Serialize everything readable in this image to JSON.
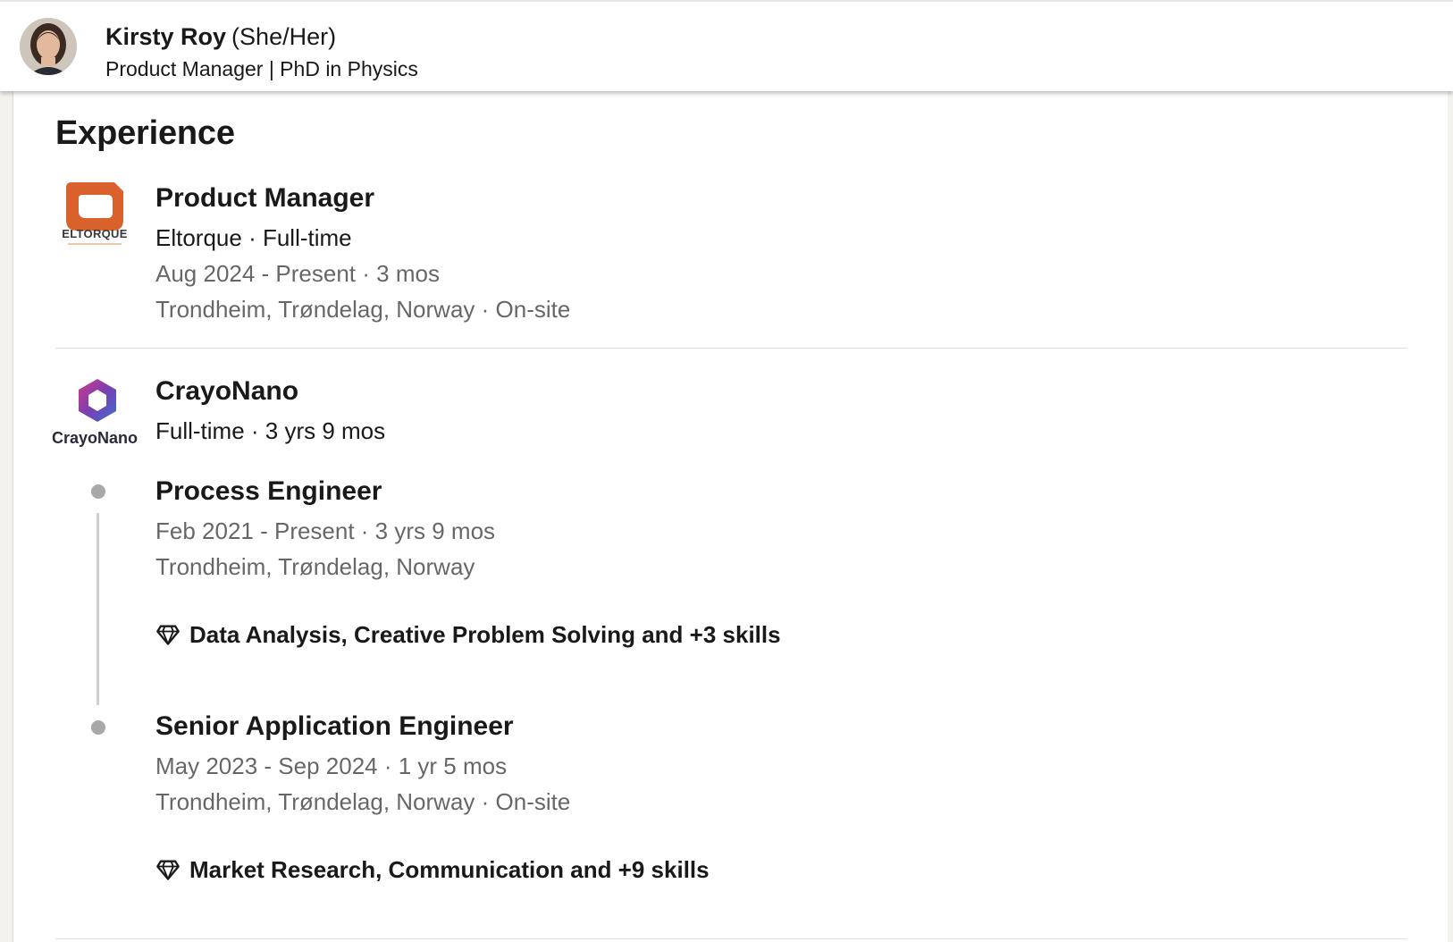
{
  "header": {
    "name": "Kirsty Roy",
    "pronouns": "(She/Her)",
    "headline": "Product Manager | PhD in Physics"
  },
  "section": {
    "title": "Experience"
  },
  "experiences": [
    {
      "logo_text": "ELTORQUE",
      "title": "Product Manager",
      "company_line": "Eltorque · Full-time",
      "dates": "Aug 2024 - Present · 3 mos",
      "location": "Trondheim, Trøndelag, Norway · On-site"
    },
    {
      "logo_text": "CrayoNano",
      "company": "CrayoNano",
      "summary": "Full-time · 3 yrs 9 mos",
      "roles": [
        {
          "title": "Process Engineer",
          "dates": "Feb 2021 - Present · 3 yrs 9 mos",
          "location": "Trondheim, Trøndelag, Norway",
          "skills": "Data Analysis, Creative Problem Solving and +3 skills"
        },
        {
          "title": "Senior Application Engineer",
          "dates": "May 2023 - Sep 2024 · 1 yr 5 mos",
          "location": "Trondheim, Trøndelag, Norway · On-site",
          "skills": "Market Research, Communication and +9 skills"
        }
      ]
    }
  ],
  "colors": {
    "eltorque_orange": "#d9612b",
    "crayonano_purple": "#7a3fb0",
    "crayonano_pink": "#d03a8c",
    "crayonano_blue": "#3a6fd0"
  },
  "icons": {
    "skills": "diamond-icon"
  }
}
